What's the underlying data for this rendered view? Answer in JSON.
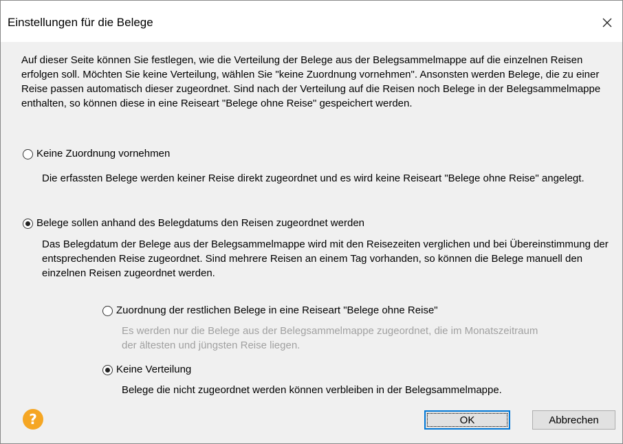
{
  "window": {
    "title": "Einstellungen für die Belege"
  },
  "intro_text": "Auf dieser Seite können Sie festlegen, wie die Verteilung der Belege aus der Belegsammelmappe auf die einzelnen Reisen erfolgen soll. Möchten Sie keine Verteilung, wählen Sie \"keine Zuordnung vornehmen\". Ansonsten werden Belege, die zu einer Reise passen automatisch dieser zugeordnet. Sind nach der Verteilung auf die Reisen noch Belege in der Belegsammelmappe enthalten, so können diese in eine Reiseart \"Belege ohne Reise\" gespeichert werden.",
  "options": {
    "no_assignment": {
      "label": "Keine Zuordnung vornehmen",
      "checked": false,
      "description": "Die erfassten Belege werden keiner Reise direkt zugeordnet und es wird keine Reiseart \"Belege ohne Reise\" angelegt."
    },
    "by_date": {
      "label": "Belege sollen anhand des Belegdatums den Reisen zugeordnet werden",
      "checked": true,
      "description": "Das Belegdatum der Belege aus der Belegsammelmappe wird mit den Reisezeiten verglichen und bei Übereinstimmung der entsprechenden Reise zugeordnet. Sind mehrere Reisen an einem Tag vorhanden, so können die Belege manuell den einzelnen Reisen zugeordnet werden."
    },
    "remaining_to_type": {
      "label": "Zuordnung der restlichen Belege in eine Reiseart \"Belege ohne Reise\"",
      "checked": false,
      "description": "Es werden nur die Belege aus der Belegsammelmappe zugeordnet, die im Monatszeitraum der ältesten und jüngsten Reise liegen."
    },
    "no_distribution": {
      "label": "Keine Verteilung",
      "checked": true,
      "description": "Belege die nicht zugeordnet werden können verbleiben in der Belegsammelmappe."
    }
  },
  "buttons": {
    "ok": "OK",
    "cancel": "Abbrechen",
    "help": "?"
  },
  "colors": {
    "help_icon": "#f5a623",
    "ok_border": "#0078d7",
    "disabled_text": "#a0a0a0",
    "dialog_bg": "#f0f0f0"
  },
  "icons": {
    "close": "close-icon",
    "help": "help-icon"
  }
}
